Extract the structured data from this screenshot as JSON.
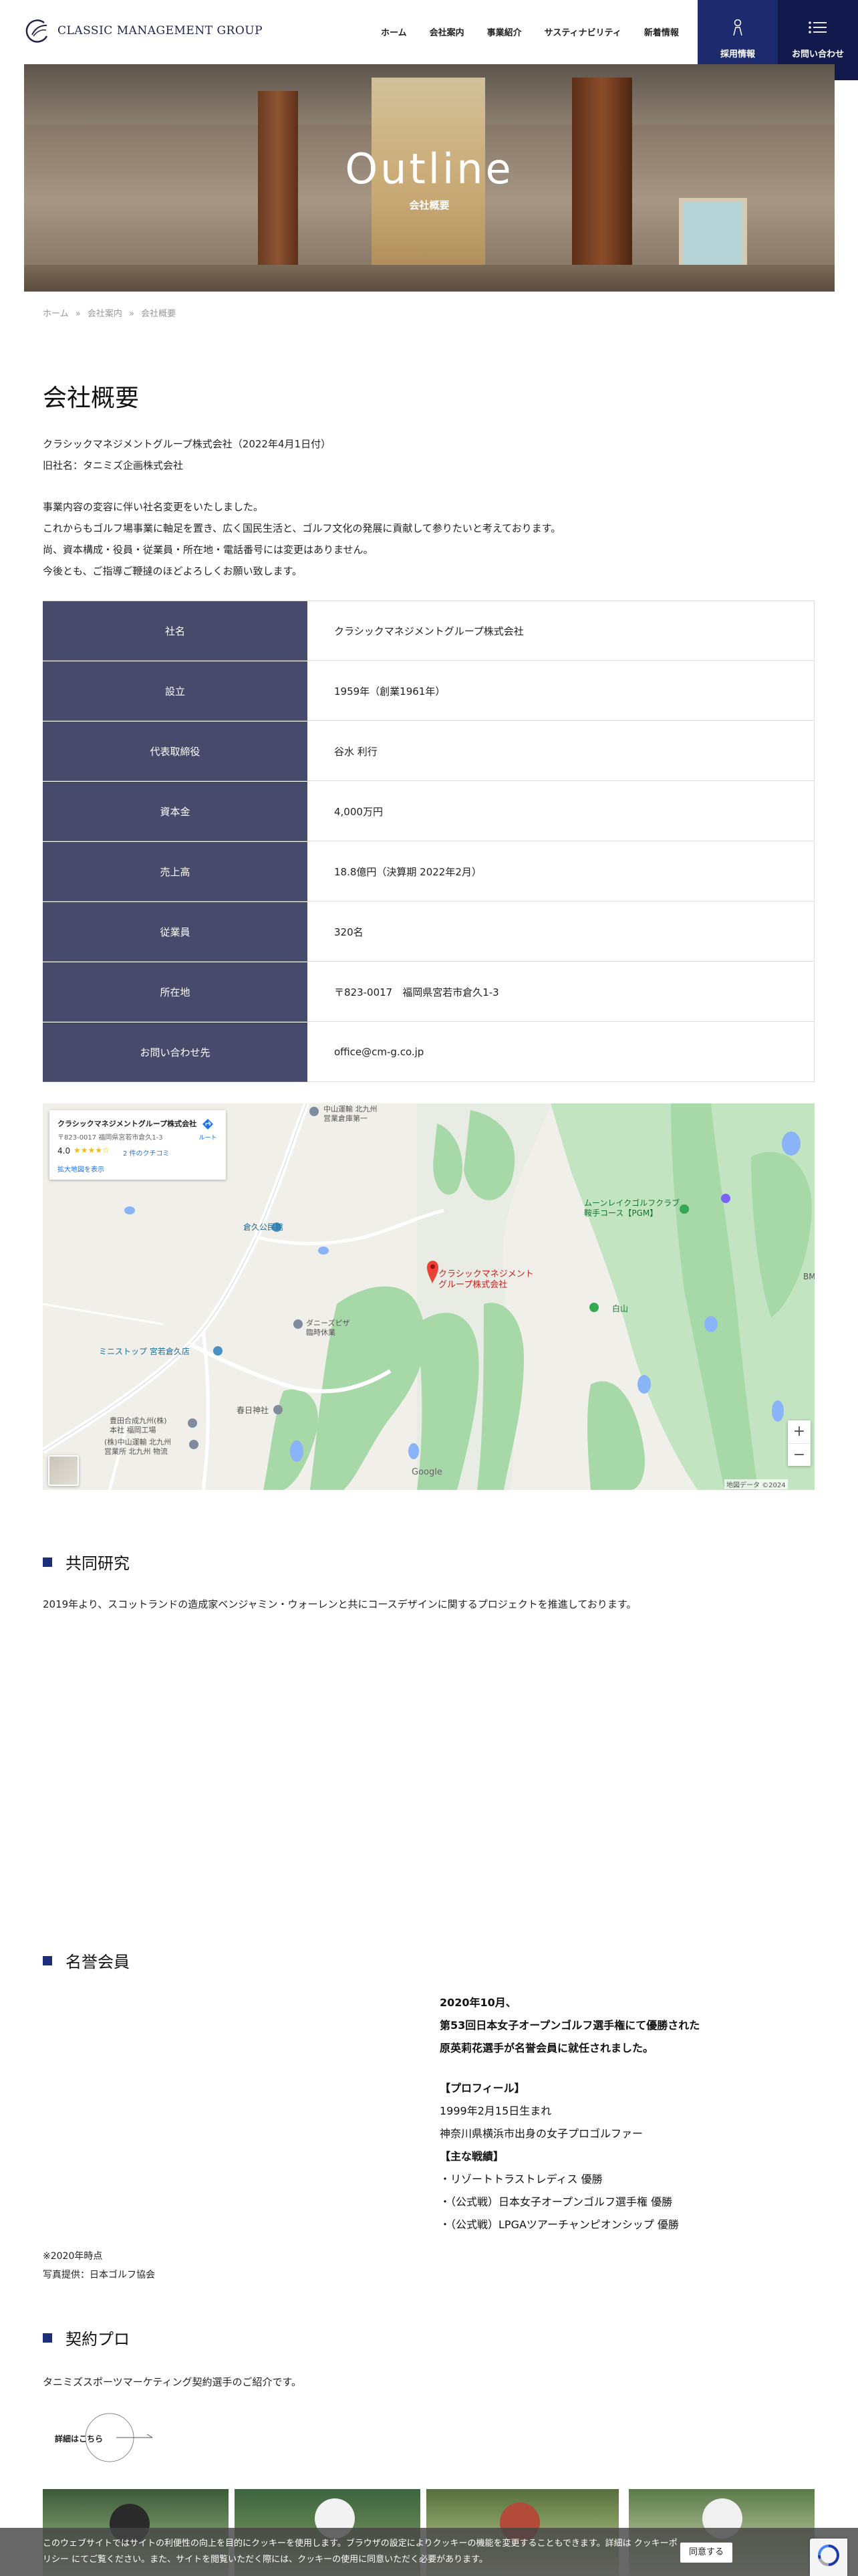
{
  "header": {
    "logo_text": "CLASSIC MANAGEMENT GROUP",
    "nav": [
      "ホーム",
      "会社案内",
      "事業紹介",
      "サスティナビリティ",
      "新着情報"
    ],
    "recruit_label": "採用情報",
    "contact_label": "お問い合わせ"
  },
  "hero": {
    "title": "Outline",
    "subtitle": "会社概要"
  },
  "breadcrumb": [
    "ホーム",
    "会社案内",
    "会社概要"
  ],
  "breadcrumb_sep": "»",
  "main": {
    "title": "会社概要",
    "intro": [
      "クラシックマネジメントグループ株式会社（2022年4月1日付）",
      "旧社名：タニミズ企画株式会社"
    ],
    "notice": [
      "事業内容の変容に伴い社名変更をいたしました。",
      "これからもゴルフ場事業に軸足を置き、広く国民生活と、ゴルフ文化の発展に貢献して参りたいと考えております。",
      "尚、資本構成・役員・従業員・所在地・電話番号には変更はありません。",
      "今後とも、ご指導ご鞭撻のほどよろしくお願い致します。"
    ]
  },
  "company_table": [
    {
      "label": "社名",
      "value": "クラシックマネジメントグループ株式会社"
    },
    {
      "label": "設立",
      "value": "1959年（創業1961年）"
    },
    {
      "label": "代表取締役",
      "value": "谷水 利行"
    },
    {
      "label": "資本金",
      "value": "4,000万円"
    },
    {
      "label": "売上高",
      "value": "18.8億円（決算期 2022年2月）"
    },
    {
      "label": "従業員",
      "value": "320名"
    },
    {
      "label": "所在地",
      "value": "〒823-0017　福岡県宮若市倉久1-3"
    },
    {
      "label": "お問い合わせ先",
      "value": "office@cm-g.co.jp"
    }
  ],
  "map": {
    "card_title": "クラシックマネジメントグループ株式会社",
    "card_address": "〒823-0017 福岡県宮若市倉久1-3",
    "rating": "4.0",
    "stars": "★★★★☆",
    "reviews": "2 件のクチコミ",
    "larger_map": "拡大地図を表示",
    "route_label": "ルート",
    "labels": {
      "marker": "クラシックマネジメント\nグループ株式会社",
      "moon_lake": "ムーンレイクゴルフクラブ\n鞍手コース【PGM】",
      "kurahisa_park": "倉久公民館",
      "ministop": "ミニストップ 宮若倉久店",
      "daniezu": "ダニーズピザ\n臨時休業",
      "kasuga": "春日神社",
      "nakayama_top": "中山運輸 北九州\n営業倉庫第一",
      "nakayama_bottom": "(株)中山運輸 北九州\n営業所 北九州 物流",
      "toyota": "豊田合成九州(株)\n本社 福岡工場",
      "hakusan": "白山",
      "bm": "BM",
      "google": "Google",
      "copyright": "地図データ ©2024"
    },
    "zoom_in": "+",
    "zoom_out": "−"
  },
  "research": {
    "heading": "共同研究",
    "text": "2019年より、スコットランドの造成家ベンジャミン・ウォーレンと共にコースデザインに関するプロジェクトを推進しております。"
  },
  "honorary": {
    "heading": "名誉会員",
    "news": [
      "2020年10月、",
      "第53回日本女子オープンゴルフ選手権にて優勝された",
      "原英莉花選手が名誉会員に就任されました。"
    ],
    "profile_heading": "【プロフィール】",
    "profile": [
      "1999年2月15日生まれ",
      "神奈川県横浜市出身の女子プロゴルファー"
    ],
    "record_heading": "【主な戦績】",
    "records": [
      "・リゾートトラストレディス 優勝",
      "・（公式戦）日本女子オープンゴルフ選手権 優勝",
      "・（公式戦）LPGAツアーチャンピオンシップ 優勝"
    ],
    "note1": "※2020年時点",
    "note2": "写真提供：日本ゴルフ協会"
  },
  "contract": {
    "heading": "契約プロ",
    "text": "タニミズスポーツマーケティング契約選手のご紹介です。",
    "more_label": "詳細はこちら"
  },
  "cookie": {
    "text": "このウェブサイトではサイトの利便性の向上を目的にクッキーを使用します。ブラウザの設定によりクッキーの機能を変更することもできます。詳細は クッキーポリシー にてご覧ください。また、サイトを閲覧いただく際には、クッキーの使用に同意いただく必要があります。",
    "agree_label": "同意する"
  },
  "colors": {
    "navy": "#1e2a6e",
    "table_header": "#474a6a",
    "accent_square": "#1d2f7a"
  }
}
